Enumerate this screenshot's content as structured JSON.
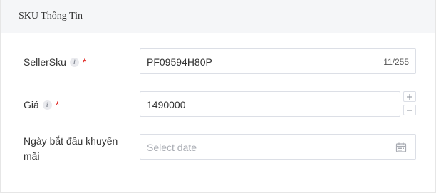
{
  "section": {
    "title": "SKU Thông Tin"
  },
  "fields": {
    "seller_sku": {
      "label": "SellerSku",
      "required_mark": "*",
      "value": "PF09594H80P",
      "counter": "11/255"
    },
    "price": {
      "label": "Giá",
      "required_mark": "*",
      "value": "1490000",
      "increment_label": "+",
      "decrement_label": "−"
    },
    "promo_start_date": {
      "label_line1": "Ngày bắt đầu khuyến",
      "label_line2": "mãi",
      "placeholder": "Select date"
    }
  },
  "icons": {
    "info": "info-icon",
    "calendar": "calendar-icon"
  },
  "colors": {
    "required": "#e0201b",
    "header_bg": "#f5f6f8",
    "border": "#dcdfe6"
  }
}
